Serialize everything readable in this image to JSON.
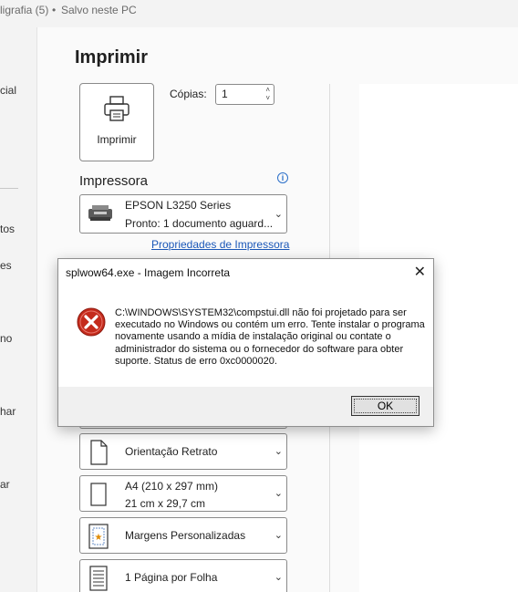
{
  "titlebar": {
    "doc": "ligrafia (5)",
    "sep": "•",
    "status": "Salvo neste PC"
  },
  "leftnav": {
    "items": [
      "cial",
      "tos",
      "es",
      "no",
      "har",
      "ar"
    ]
  },
  "print": {
    "title": "Imprimir",
    "button_label": "Imprimir",
    "copies_label": "Cópias:",
    "copies_value": "1"
  },
  "printer": {
    "section_title": "Impressora",
    "info_glyph": "i",
    "name": "EPSON L3250 Series",
    "status": "Pronto: 1 documento aguard...",
    "properties_link": "Propriedades de Impressora"
  },
  "settings": [
    {
      "line1": "Orientação Retrato",
      "line2": ""
    },
    {
      "line1": "A4 (210 x 297 mm)",
      "line2": "21 cm x 29,7 cm"
    },
    {
      "line1": "Margens Personalizadas",
      "line2": ""
    },
    {
      "line1": "1 Página por Folha",
      "line2": ""
    }
  ],
  "dialog": {
    "title": "splwow64.exe - Imagem Incorreta",
    "message": "C:\\WINDOWS\\SYSTEM32\\compstui.dll não foi projetado para ser executado no Windows ou contém um erro. Tente instalar o programa novamente usando a mídia de instalação original ou contate o administrador do sistema ou o fornecedor do software para obter suporte. Status de erro 0xc0000020.",
    "ok_label": "OK",
    "close_glyph": "✕"
  },
  "icons": {
    "printer": "printer-icon",
    "error": "error-icon",
    "chevron": "chevron-down-icon",
    "orientation": "portrait-page-icon",
    "paper": "paper-size-icon",
    "margins": "margins-icon",
    "pages": "pages-per-sheet-icon"
  },
  "colors": {
    "link": "#1a57b8",
    "error": "#c42b1c",
    "info": "#2b6fc9"
  }
}
